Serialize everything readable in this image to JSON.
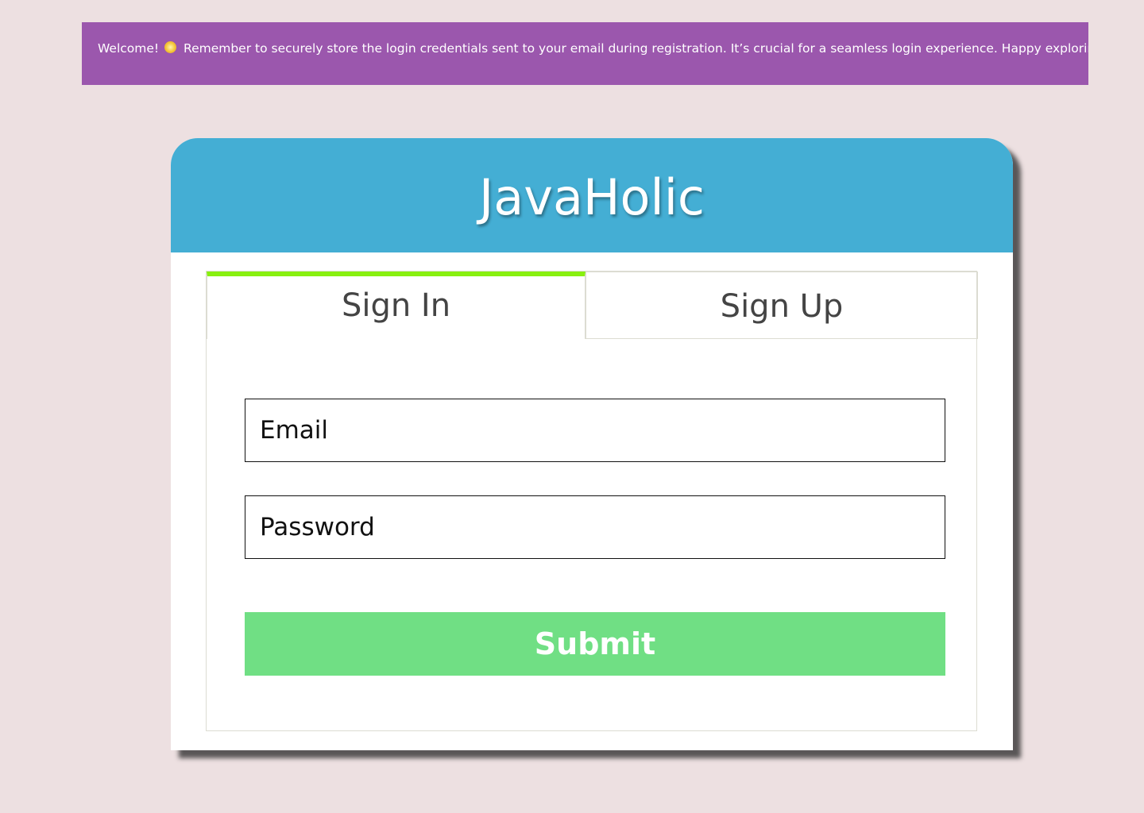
{
  "banner": {
    "welcome": "Welcome!",
    "message": "Remember to securely store the login credentials sent to your email during registration. It’s crucial for a seamless login experience. Happy exploring!",
    "emojis": [
      "sparkle-emoji",
      "smile-emoji"
    ],
    "background_color": "#9b57ad"
  },
  "app": {
    "title": "JavaHolic",
    "header_color": "#44aed4"
  },
  "tabs": [
    {
      "label": "Sign In",
      "active": true
    },
    {
      "label": "Sign Up",
      "active": false
    }
  ],
  "form": {
    "email_placeholder": "Email",
    "password_placeholder": "Password",
    "submit_label": "Submit",
    "submit_color": "#70df84",
    "active_tab_accent": "#88f010"
  }
}
